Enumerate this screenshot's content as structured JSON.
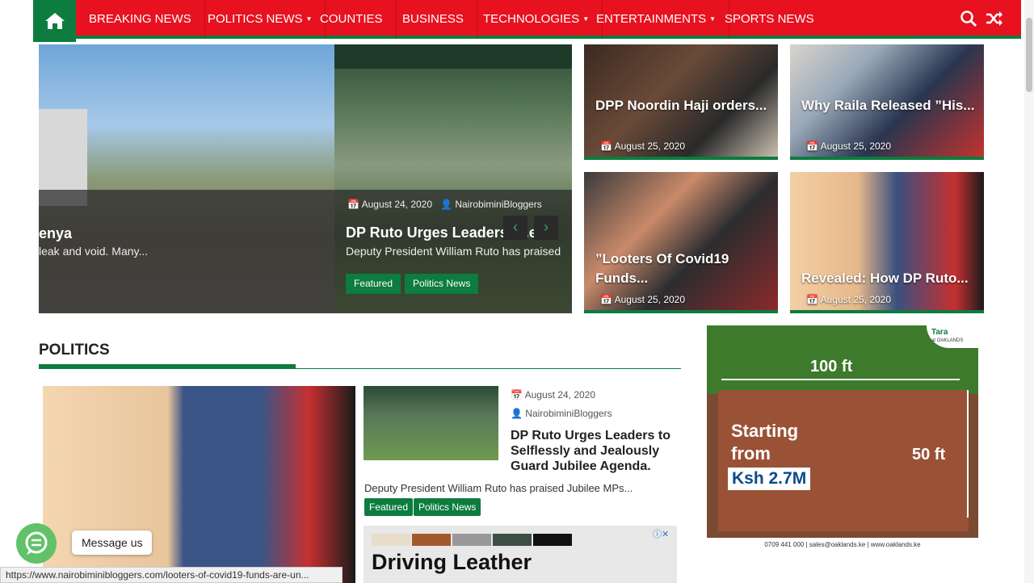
{
  "nav": {
    "items": [
      {
        "label": "BREAKING NEWS",
        "caret": false
      },
      {
        "label": "POLITICS NEWS",
        "caret": true
      },
      {
        "label": "COUNTIES",
        "caret": false
      },
      {
        "label": "BUSINESS",
        "caret": false
      },
      {
        "label": "TECHNOLOGIES",
        "caret": true
      },
      {
        "label": "ENTERTAINMENTS",
        "caret": true
      },
      {
        "label": "SPORTS NEWS",
        "caret": false
      }
    ],
    "icons": [
      "home-icon",
      "search-icon",
      "shuffle-icon"
    ]
  },
  "slider": {
    "slide_a": {
      "title": "enya",
      "excerpt": "leak and void. Many..."
    },
    "slide_b": {
      "date": "August 24, 2020",
      "author": "NairobiminiBloggers",
      "title": "DP Ruto Urges Leaders t...essl",
      "excerpt": "Deputy President William Ruto has praised",
      "tags": [
        "Featured",
        "Politics News"
      ]
    }
  },
  "tiles": [
    {
      "title": "DPP Noordin Haji orders...",
      "date": "August 25, 2020"
    },
    {
      "title": "Why Raila Released ”His...",
      "date": "August 25, 2020"
    },
    {
      "title": "”Looters Of Covid19 Funds...",
      "date": "August 25, 2020"
    },
    {
      "title": "Revealed: How DP Ruto...",
      "date": "August 25, 2020"
    }
  ],
  "politics": {
    "heading": "POLITICS",
    "post": {
      "date": "August 24, 2020",
      "author": "NairobiminiBloggers",
      "title": "DP Ruto Urges Leaders to Selflessly and Jealously Guard Jubilee Agenda.",
      "excerpt": "Deputy President William Ruto has praised Jubilee MPs...",
      "tags": [
        "Featured",
        "Politics News"
      ]
    }
  },
  "ads": {
    "small_title": "Driving Leather",
    "right": {
      "brand": "Tara",
      "brand_sub": "at OAKLANDS",
      "width": "100 ft",
      "height": "50 ft",
      "line1": "Starting",
      "line2": "from",
      "price": "Ksh 2.7M",
      "footer": "0709 441 000  |  sales@oaklands.ke  |  www.oaklands.ke"
    }
  },
  "chat": {
    "label": "Message us"
  },
  "status_url": "https://www.nairobiminibloggers.com/looters-of-covid19-funds-are-un...",
  "colors": {
    "brand_red": "#e8111f",
    "brand_green": "#0c7c3f"
  }
}
